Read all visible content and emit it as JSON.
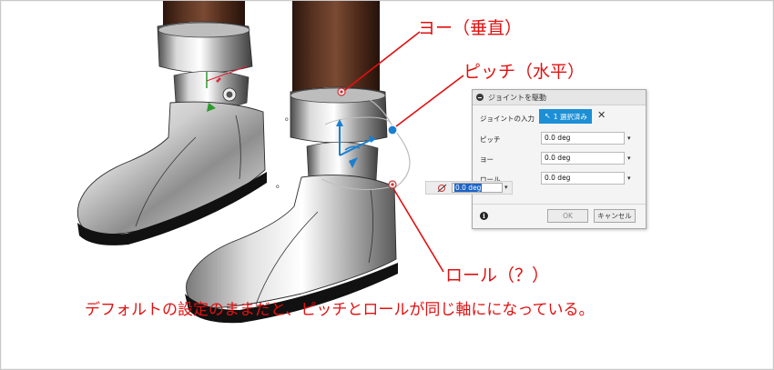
{
  "annotations": {
    "yaw": "ヨー（垂直）",
    "pitch": "ピッチ（水平）",
    "roll": "ロール（？）",
    "note": "デフォルトの設定のままだと、ピッチとロールが同じ軸にになっている。"
  },
  "dialog": {
    "title": "ジョイントを駆動",
    "input_label": "ジョイントの入力",
    "selection_label": "1 選択済み",
    "fields": {
      "pitch": {
        "label": "ピッチ",
        "value": "0.0 deg"
      },
      "yaw": {
        "label": "ヨー",
        "value": "0.0 deg"
      },
      "roll": {
        "label": "ロール",
        "value": "0.0 deg"
      }
    },
    "ok_label": "OK",
    "cancel_label": "キャンセル"
  },
  "canvas_widget": {
    "value": "0.0 deg"
  },
  "colors": {
    "annotation": "#e01010",
    "selection_blue": "#1c8fd6",
    "handle_blue": "#1a7fd0"
  },
  "icons": [
    "collapse-icon",
    "cursor-icon",
    "close-icon",
    "dropdown-icon",
    "info-icon",
    "joint-icon"
  ]
}
